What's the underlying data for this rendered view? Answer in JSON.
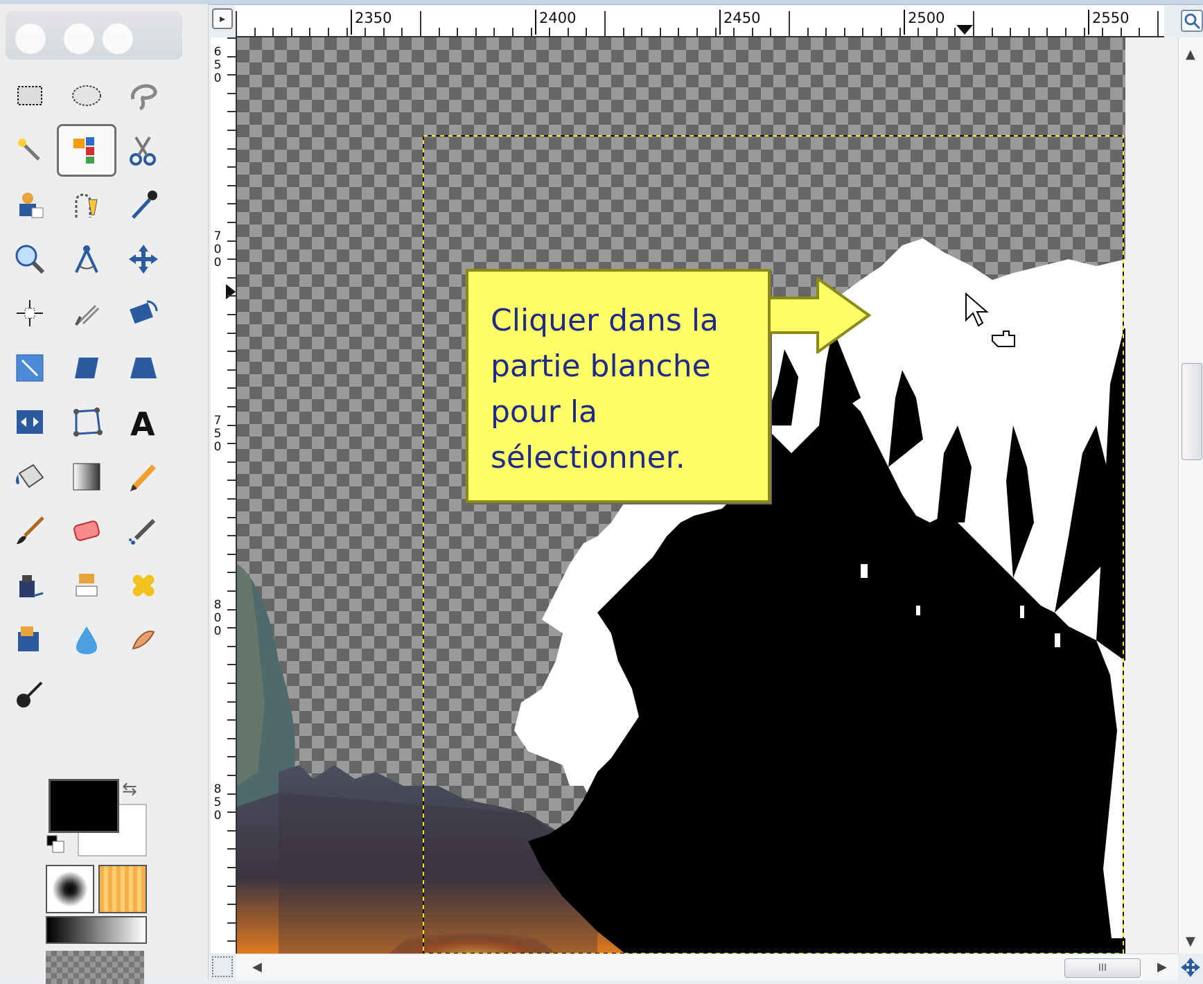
{
  "ruler": {
    "horizontal_labels": [
      "2350",
      "2400",
      "2450",
      "2500",
      "2550"
    ],
    "vertical_labels": [
      "650",
      "700",
      "750",
      "800",
      "850"
    ]
  },
  "callout": {
    "text": "Cliquer dans la\npartie blanche\npour la\nsélectionner."
  },
  "toolbox": {
    "tools": [
      "rect-select-tool",
      "ellipse-select-tool",
      "free-select-tool",
      "fuzzy-select-tool",
      "select-by-color-tool",
      "scissors-select-tool",
      "foreground-select-tool",
      "paths-tool",
      "color-picker-tool",
      "zoom-tool",
      "measure-tool",
      "move-tool",
      "align-tool",
      "crop-tool",
      "rotate-tool",
      "scale-tool",
      "shear-tool",
      "perspective-tool",
      "flip-tool",
      "cage-tool",
      "text-tool",
      "bucket-fill-tool",
      "blend-tool",
      "pencil-tool",
      "paintbrush-tool",
      "eraser-tool",
      "airbrush-tool",
      "ink-tool",
      "clone-tool",
      "heal-tool",
      "perspective-clone-tool",
      "blur-tool",
      "smudge-tool",
      "dodge-burn-tool"
    ],
    "active_tool": "select-by-color-tool",
    "foreground_color": "#000000",
    "background_color": "#ffffff"
  },
  "colors": {
    "selection_marquee": "#f5e51a",
    "callout_fill": "#ffff66",
    "callout_text": "#1f2a8a"
  }
}
